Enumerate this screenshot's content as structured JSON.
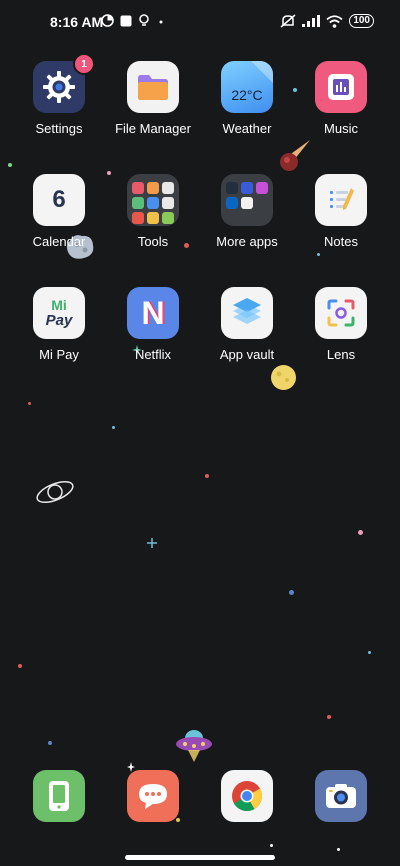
{
  "status_bar": {
    "time": "8:16 AM",
    "battery": "100"
  },
  "home": {
    "apps": [
      {
        "label": "Settings",
        "badge": "1"
      },
      {
        "label": "File Manager"
      },
      {
        "label": "Weather",
        "temp": "22°C"
      },
      {
        "label": "Music"
      },
      {
        "label": "Calendar",
        "day": "6"
      },
      {
        "label": "Tools"
      },
      {
        "label": "More apps"
      },
      {
        "label": "Notes"
      },
      {
        "label": "Mi Pay",
        "mark_top": "Mi",
        "mark_bottom": "Pay"
      },
      {
        "label": "Netflix",
        "mark": "N"
      },
      {
        "label": "App vault"
      },
      {
        "label": "Lens"
      }
    ]
  },
  "dock": {
    "apps": [
      {
        "name": "Phone"
      },
      {
        "name": "Messaging"
      },
      {
        "name": "Chrome"
      },
      {
        "name": "Camera"
      }
    ]
  },
  "colors": {
    "background": "#17181a",
    "badge": "#f0567c",
    "settings": "#2f3a66",
    "weather": "#3fa6f5",
    "music": "#f05a7e",
    "netflix": "#5a86e8",
    "phone": "#6dbf6a",
    "messaging": "#ef6f58",
    "camera": "#5e76ae"
  }
}
